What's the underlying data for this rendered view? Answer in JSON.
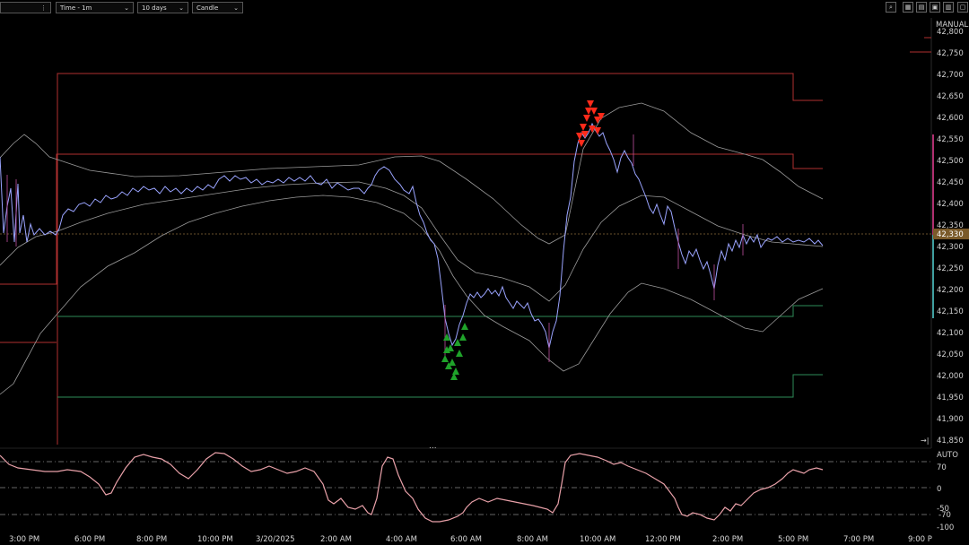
{
  "toolbar": {
    "symbol_value": "",
    "interval": "Time - 1m",
    "range": "10 days",
    "style": "Candle",
    "more": "⋮"
  },
  "price_axis": {
    "mode": "MANUAL",
    "ticks": [
      "42,800",
      "42,750",
      "42,700",
      "42,650",
      "42,600",
      "42,550",
      "42,500",
      "42,450",
      "42,400",
      "42,350",
      "42,300",
      "42,250",
      "42,200",
      "42,150",
      "42,100",
      "42,050",
      "42,000",
      "41,950",
      "41,900",
      "41,850"
    ],
    "last_price": "42,330"
  },
  "oscillator_axis": {
    "mode": "AUTO",
    "ticks": [
      "70",
      "0",
      "-50",
      "-70",
      "-100"
    ]
  },
  "time_axis": [
    "3:00 PM",
    "6:00 PM",
    "8:00 PM",
    "10:00 PM",
    "3/20/2025",
    "2:00 AM",
    "4:00 AM",
    "6:00 AM",
    "8:00 AM",
    "10:00 AM",
    "12:00 PM",
    "2:00 PM",
    "5:00 PM",
    "7:00 PM",
    "9:00 P"
  ],
  "colors": {
    "red_band": "#b03030",
    "green_band": "#2e8b57",
    "price_line": "#9aa4ff",
    "bull_marker": "#1fa22a",
    "bear_marker": "#ff2a1a",
    "envelope": "#bdbdbd",
    "oscillator": "#e8a0a8",
    "last_price_badge": "#7a5a2a"
  },
  "panel_separator": "...",
  "scroll_arrow": "→|"
}
